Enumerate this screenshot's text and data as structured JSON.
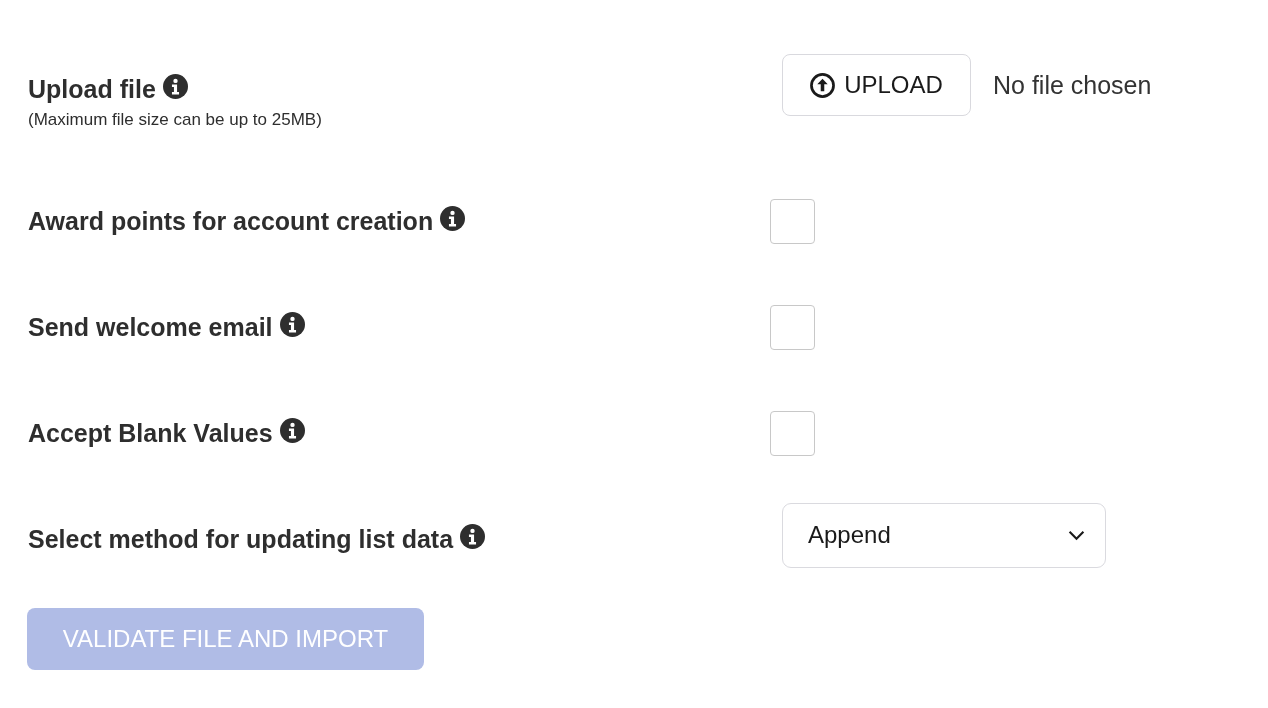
{
  "fields": [
    {
      "kind": "file",
      "label": "Upload file",
      "info": true,
      "note": "(Maximum file size can be up to 25MB)",
      "button": "UPLOAD",
      "status": "No file chosen"
    },
    {
      "kind": "checkbox",
      "label": "Award points for account creation",
      "info": true,
      "checked": false
    },
    {
      "kind": "checkbox",
      "label": "Send welcome email",
      "info": true,
      "checked": false
    },
    {
      "kind": "checkbox",
      "label": "Accept Blank Values",
      "info": true,
      "checked": false
    },
    {
      "kind": "select",
      "label": "Select method for updating list data",
      "info": true,
      "value": "Append"
    }
  ],
  "submit": {
    "label": "VALIDATE FILE AND IMPORT",
    "disabled": true
  }
}
